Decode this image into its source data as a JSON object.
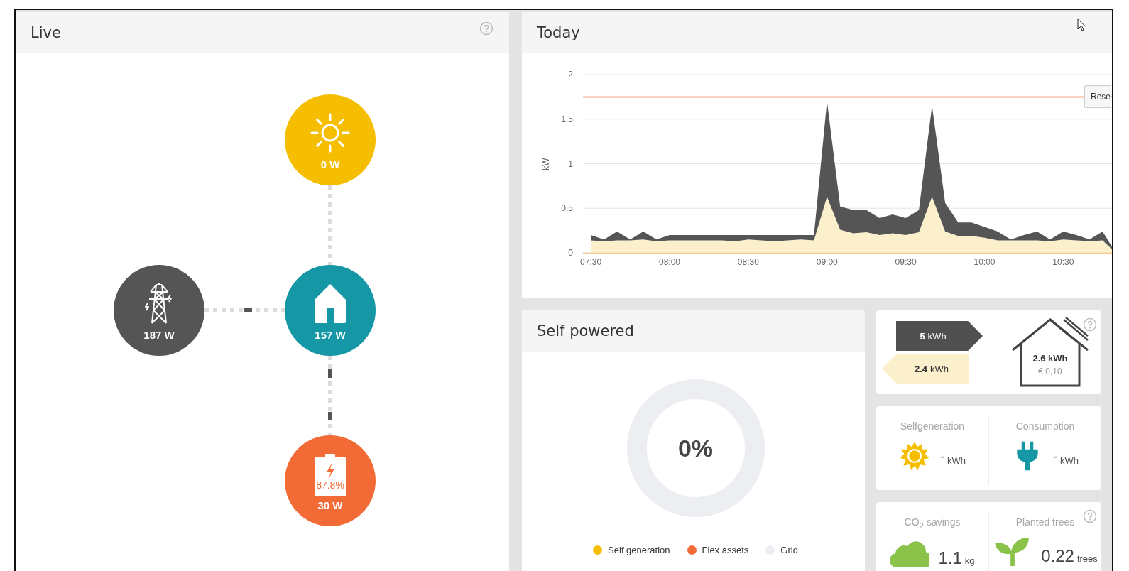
{
  "live": {
    "title": "Live",
    "nodes": [
      {
        "kind": "solar",
        "value": "0 W",
        "color": "#f6be00"
      },
      {
        "kind": "grid",
        "value": "187 W",
        "color": "#555555"
      },
      {
        "kind": "home",
        "value": "157 W",
        "color": "#1597a5"
      },
      {
        "kind": "battery",
        "value": "30 W",
        "charge": "87.8%",
        "color": "#f26a35"
      }
    ]
  },
  "today": {
    "title": "Today",
    "reset_button": "Rese",
    "chart_data": {
      "type": "area",
      "ylabel": "kW",
      "stacked": true,
      "grid": true,
      "x": [
        450,
        455,
        460,
        465,
        470,
        475,
        480,
        485,
        490,
        495,
        500,
        505,
        510,
        515,
        520,
        525,
        530,
        535,
        540,
        545,
        550,
        555,
        560,
        565,
        570,
        575,
        580,
        585,
        590,
        595,
        600,
        605,
        610,
        615,
        620,
        625,
        630,
        635,
        640,
        645,
        650
      ],
      "series": [
        {
          "color": "#fcf0cc",
          "values": [
            0.14,
            0.13,
            0.14,
            0.14,
            0.15,
            0.13,
            0.14,
            0.14,
            0.14,
            0.14,
            0.14,
            0.13,
            0.15,
            0.14,
            0.13,
            0.14,
            0.15,
            0.14,
            0.63,
            0.26,
            0.22,
            0.23,
            0.2,
            0.22,
            0.2,
            0.23,
            0.63,
            0.24,
            0.19,
            0.19,
            0.17,
            0.14,
            0.14,
            0.14,
            0.14,
            0.13,
            0.15,
            0.14,
            0.13,
            0.14,
            0
          ]
        },
        {
          "color": "#555555",
          "values": [
            0.06,
            0.02,
            0.1,
            0.01,
            0.09,
            0.02,
            0.06,
            0.06,
            0.06,
            0.06,
            0.06,
            0.07,
            0.05,
            0.06,
            0.07,
            0.06,
            0.05,
            0.06,
            1.07,
            0.26,
            0.26,
            0.25,
            0.19,
            0.21,
            0.19,
            0.25,
            1.02,
            0.32,
            0.15,
            0.15,
            0.12,
            0.1,
            0.01,
            0.06,
            0.1,
            0.02,
            0.09,
            0.06,
            0.02,
            0.1,
            0
          ]
        }
      ],
      "ylim": [
        0,
        2
      ],
      "yticks": [
        0,
        0.5,
        1,
        1.5,
        2
      ],
      "xticks": [
        {
          "value": 450,
          "label": "07:30"
        },
        {
          "value": 480,
          "label": "08:00"
        },
        {
          "value": 510,
          "label": "08:30"
        },
        {
          "value": 540,
          "label": "09:00"
        },
        {
          "value": 570,
          "label": "09:30"
        },
        {
          "value": 600,
          "label": "10:00"
        },
        {
          "value": 630,
          "label": "10:30"
        }
      ],
      "xlim": [
        447,
        651
      ],
      "ref_lines": [
        {
          "axis": "y",
          "value": 1.75,
          "color": "#f4a582"
        }
      ]
    }
  },
  "self_powered": {
    "title": "Self powered",
    "percent": "0%",
    "legend": [
      {
        "label": "Self generation",
        "color": "#f6be00"
      },
      {
        "label": "Flex assets",
        "color": "#f26a35"
      },
      {
        "label": "Grid",
        "color": "#eceef2"
      }
    ]
  },
  "energy_flow": {
    "export": "**5** kWh",
    "import": "**2.4** kWh",
    "home_value": "2.6 kWh",
    "home_cost": "€ 0,10"
  },
  "totals": [
    {
      "kind": "sun",
      "label": "Selfgeneration",
      "value": "-",
      "unit": "kWh"
    },
    {
      "kind": "plug",
      "label": "Consumption",
      "value": "-",
      "unit": "kWh"
    }
  ],
  "impact": [
    {
      "kind": "cloud",
      "label": "CO$_{2}$ savings",
      "value": "1.1",
      "unit": "kg"
    },
    {
      "kind": "sprout",
      "label": "Planted trees",
      "value": "0.22",
      "unit": "trees"
    }
  ]
}
